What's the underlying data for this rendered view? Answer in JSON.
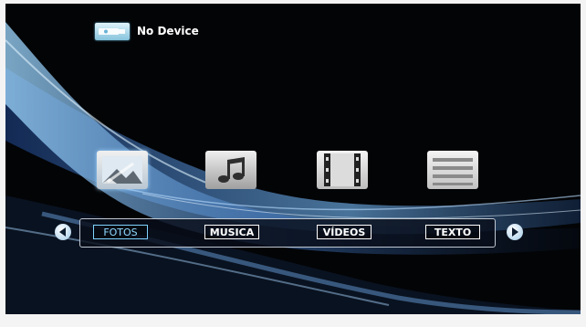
{
  "device": {
    "icon": "usb-drive-icon",
    "label": "No Device"
  },
  "media": {
    "tabs": [
      {
        "label": "FOTOS",
        "icon": "photos-icon",
        "selected": true
      },
      {
        "label": "MUSICA",
        "icon": "music-icon",
        "selected": false
      },
      {
        "label": "VÍDEOS",
        "icon": "video-icon",
        "selected": false
      },
      {
        "label": "TEXTO",
        "icon": "text-icon",
        "selected": false
      }
    ]
  },
  "navigation": {
    "prev_icon": "arrow-left-icon",
    "next_icon": "arrow-right-icon"
  },
  "colors": {
    "background": "#030406",
    "accent": "#7fd3ff",
    "text": "#ffffff"
  }
}
